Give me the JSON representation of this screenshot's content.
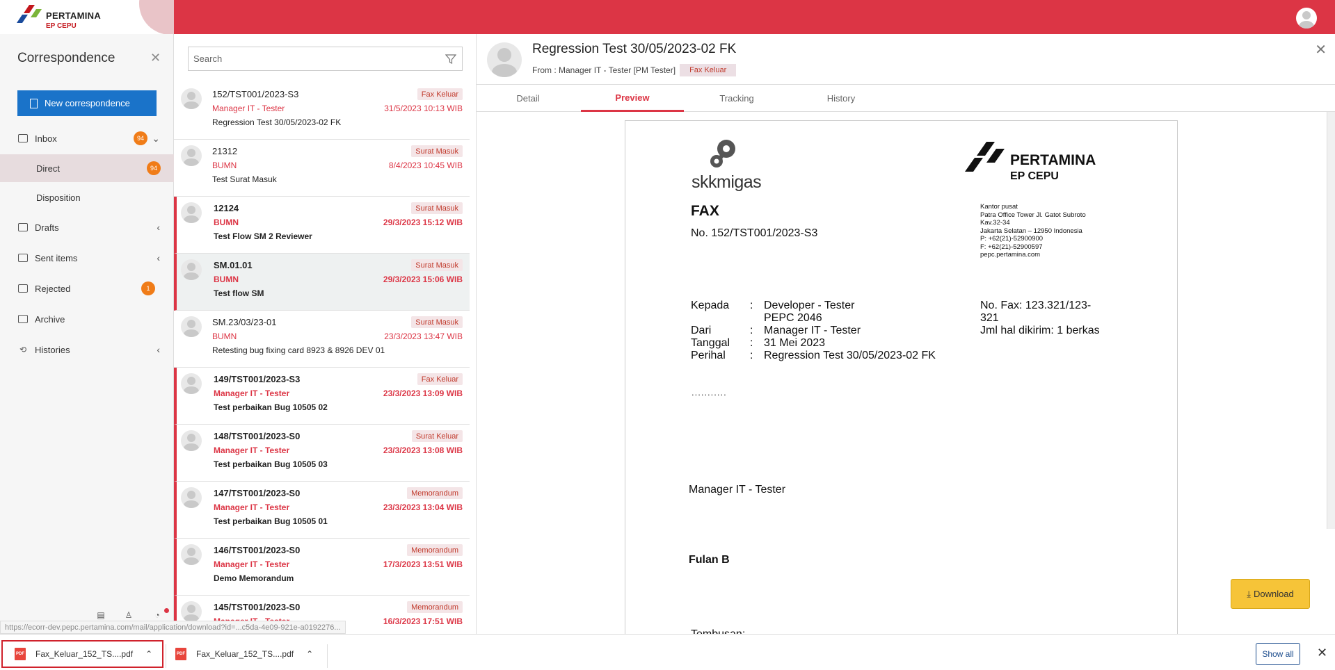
{
  "brand": {
    "name": "PERTAMINA",
    "sub": "EP CEPU"
  },
  "sidebar": {
    "title": "Correspondence",
    "new_button": "New correspondence",
    "items": [
      {
        "label": "Inbox",
        "badge": "94",
        "chevron": "⌄"
      },
      {
        "label": "Direct",
        "badge": "94"
      },
      {
        "label": "Disposition"
      },
      {
        "label": "Drafts",
        "chevron": "‹"
      },
      {
        "label": "Sent items",
        "chevron": "‹"
      },
      {
        "label": "Rejected",
        "badge": "1"
      },
      {
        "label": "Archive"
      },
      {
        "label": "Histories",
        "chevron": "‹"
      }
    ]
  },
  "search": {
    "placeholder": "Search"
  },
  "list": [
    {
      "number": "152/TST001/2023-S3",
      "sender": "Manager IT - Tester",
      "subject": "Regression Test 30/05/2023-02 FK",
      "tag": "Fax Keluar",
      "date": "31/5/2023 10:13 WIB",
      "unread": false,
      "selected": false
    },
    {
      "number": "21312",
      "sender": "BUMN",
      "subject": "Test Surat Masuk",
      "tag": "Surat Masuk",
      "date": "8/4/2023 10:45 WIB",
      "unread": false,
      "selected": false
    },
    {
      "number": "12124",
      "sender": "BUMN",
      "subject": "Test Flow SM 2 Reviewer",
      "tag": "Surat Masuk",
      "date": "29/3/2023 15:12 WIB",
      "unread": true,
      "selected": false
    },
    {
      "number": "SM.01.01",
      "sender": "BUMN",
      "subject": "Test flow SM",
      "tag": "Surat Masuk",
      "date": "29/3/2023 15:06 WIB",
      "unread": true,
      "selected": true
    },
    {
      "number": "SM.23/03/23-01",
      "sender": "BUMN",
      "subject": "Retesting bug fixing card 8923 & 8926 DEV 01",
      "tag": "Surat Masuk",
      "date": "23/3/2023 13:47 WIB",
      "unread": false,
      "selected": false
    },
    {
      "number": "149/TST001/2023-S3",
      "sender": "Manager IT - Tester",
      "subject": "Test perbaikan Bug 10505 02",
      "tag": "Fax Keluar",
      "date": "23/3/2023 13:09 WIB",
      "unread": true,
      "selected": false
    },
    {
      "number": "148/TST001/2023-S0",
      "sender": "Manager IT - Tester",
      "subject": "Test perbaikan Bug 10505 03",
      "tag": "Surat Keluar",
      "date": "23/3/2023 13:08 WIB",
      "unread": true,
      "selected": false
    },
    {
      "number": "147/TST001/2023-S0",
      "sender": "Manager IT - Tester",
      "subject": "Test perbaikan Bug 10505 01",
      "tag": "Memorandum",
      "date": "23/3/2023 13:04 WIB",
      "unread": true,
      "selected": false
    },
    {
      "number": "146/TST001/2023-S0",
      "sender": "Manager IT - Tester",
      "subject": "Demo Memorandum",
      "tag": "Memorandum",
      "date": "17/3/2023 13:51 WIB",
      "unread": true,
      "selected": false
    },
    {
      "number": "145/TST001/2023-S0",
      "sender": "Manager IT - Tester",
      "subject": "",
      "tag": "Memorandum",
      "date": "16/3/2023 17:51 WIB",
      "unread": true,
      "selected": false
    }
  ],
  "detail": {
    "title": "Regression Test 30/05/2023-02 FK",
    "from": "From : Manager IT - Tester [PM Tester]",
    "tag": "Fax Keluar",
    "tabs": [
      "Detail",
      "Preview",
      "Tracking",
      "History"
    ],
    "active_tab": "Preview",
    "download": "Download"
  },
  "document": {
    "left_logo": "skkmigas",
    "right_logo": {
      "name": "PERTAMINA",
      "sub": "EP CEPU"
    },
    "heading": "FAX",
    "number": "No. 152/TST001/2023-S3",
    "address": [
      "Kantor pusat",
      "Patra Office Tower Jl. Gatot Subroto",
      "Kav.32-34",
      "Jakarta Selatan – 12950 Indonesia",
      "P: +62(21)-52900900",
      "F: +62(21)-52900597",
      "pepc.pertamina.com"
    ],
    "fields": [
      {
        "label": "Kepada",
        "sep": ":",
        "value": "Developer - Tester"
      },
      {
        "label": "",
        "sep": "",
        "value": "PEPC 2046"
      },
      {
        "label": "Dari",
        "sep": ":",
        "value": "Manager IT - Tester"
      },
      {
        "label": "Tanggal",
        "sep": ":",
        "value": "31 Mei 2023"
      },
      {
        "label": "Perihal",
        "sep": ":",
        "value": "Regression Test 30/05/2023-02 FK"
      }
    ],
    "fax_no": "No. Fax: 123.321/123-",
    "fax_no_cont": "321",
    "pages": "Jml hal dikirim:  1 berkas",
    "dots": "...........",
    "signer_title": "Manager IT - Tester",
    "signer_name": "Fulan B",
    "tembusan": "Tembusan:"
  },
  "status_url": "https://ecorr-dev.pepc.pertamina.com/mail/application/download?id=...c5da-4e09-921e-a0192276...",
  "downloads": [
    {
      "name": "Fax_Keluar_152_TS....pdf",
      "icon_label": "PDF"
    },
    {
      "name": "Fax_Keluar_152_TS....pdf",
      "icon_label": "PDF"
    }
  ],
  "shelf": {
    "show_all": "Show all"
  },
  "colors": {
    "primary_red": "#dc3545",
    "accent_blue": "#1a73c9",
    "badge_orange": "#f07c18",
    "download_yellow": "#f6c438"
  }
}
